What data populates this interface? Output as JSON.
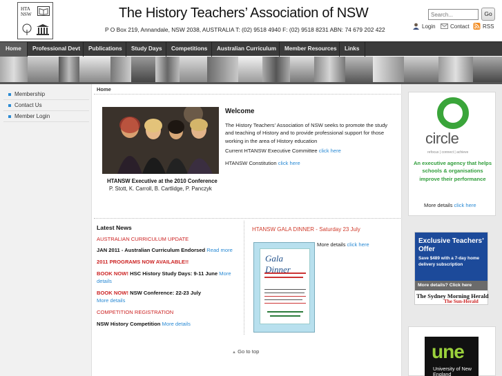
{
  "header": {
    "logo_text": [
      "HTA",
      "NSW"
    ],
    "title": "The History Teachers’ Association of NSW",
    "address": "P O Box 219, Annandale, NSW 2038, AUSTRALIA   T: (02) 9518 4940  F: (02) 9518 8231   ABN: 74 679 202 422",
    "search_placeholder": "Search...",
    "go_label": "Go",
    "links": {
      "login": "Login",
      "contact": "Contact",
      "rss": "RSS"
    }
  },
  "nav": {
    "items": [
      {
        "label": "Home",
        "active": true
      },
      {
        "label": "Professional Devt"
      },
      {
        "label": "Publications"
      },
      {
        "label": "Study Days"
      },
      {
        "label": "Competitions"
      },
      {
        "label": "Australian Curriculum"
      },
      {
        "label": "Member Resources"
      },
      {
        "label": "Links"
      }
    ]
  },
  "sidebar": {
    "items": [
      {
        "label": "Membership"
      },
      {
        "label": "Contact Us"
      },
      {
        "label": "Member Login"
      }
    ]
  },
  "breadcrumb": "Home",
  "welcome": {
    "heading": "Welcome",
    "intro": "The History Teachers’ Association of NSW seeks to promote the study and teaching of History and to provide professional support for those working in the area of History education",
    "committee_text": "Current HTANSW Executive Committee",
    "committee_link": "click here",
    "constitution_text": "HTANSW Constitution",
    "constitution_link": "click here",
    "caption_title": "HTANSW Executive at the 2010 Conference",
    "caption_names": "P. Stott, K. Carroll, B. Cartlidge, P. Panczyk"
  },
  "news": {
    "heading": "Latest News",
    "items": {
      "ac_update": "AUSTRALIAN CURRICULUM UPDATE",
      "jan_text": "JAN 2011 - Australian Curriculum Endorsed",
      "read_more": "Read more",
      "programs": "2011 PROGRAMS NOW AVAILABLE!!",
      "book_now_1": "BOOK NOW!",
      "hsc_text": "HSC History Study Days: 9-11 June",
      "more_1": "More",
      "details_1": "details",
      "book_now_2": "BOOK NOW!",
      "conf_text": "NSW Conference: 22-23 July",
      "more_details_2": "More details",
      "comp_reg": "COMPETITION REGISTRATION",
      "comp_text": "NSW History Competition",
      "more_details_3": "More details"
    }
  },
  "gala": {
    "heading": "HTANSW GALA DINNER - Saturday 23 July",
    "more_text": "More details",
    "more_link": "click here",
    "poster_title": "Gala Dinner"
  },
  "go_top": "Go to top",
  "ads": {
    "circle": {
      "word": "circle",
      "tagline": "refocus  |  connect  |  achieve",
      "text": "An executive agency that helps schools & organisations improve their performance",
      "more_text": "More details",
      "more_link": "click here"
    },
    "smh": {
      "heading": "Exclusive Teachers’ Offer",
      "sub": "Save $489 with a 7-day home delivery subscription",
      "bar": "More details? Click here",
      "paper1": "The Sydney Morning Herald",
      "paper2": "The Sun-Herald"
    },
    "une": {
      "logo": "une",
      "sub": "University of New England"
    }
  },
  "colors": {
    "link": "#2a8ad4",
    "accent_red": "#c22222",
    "nav_bg": "#3b3b3b",
    "circle_green": "#2f9d3a",
    "smh_blue": "#1c4a9a"
  }
}
